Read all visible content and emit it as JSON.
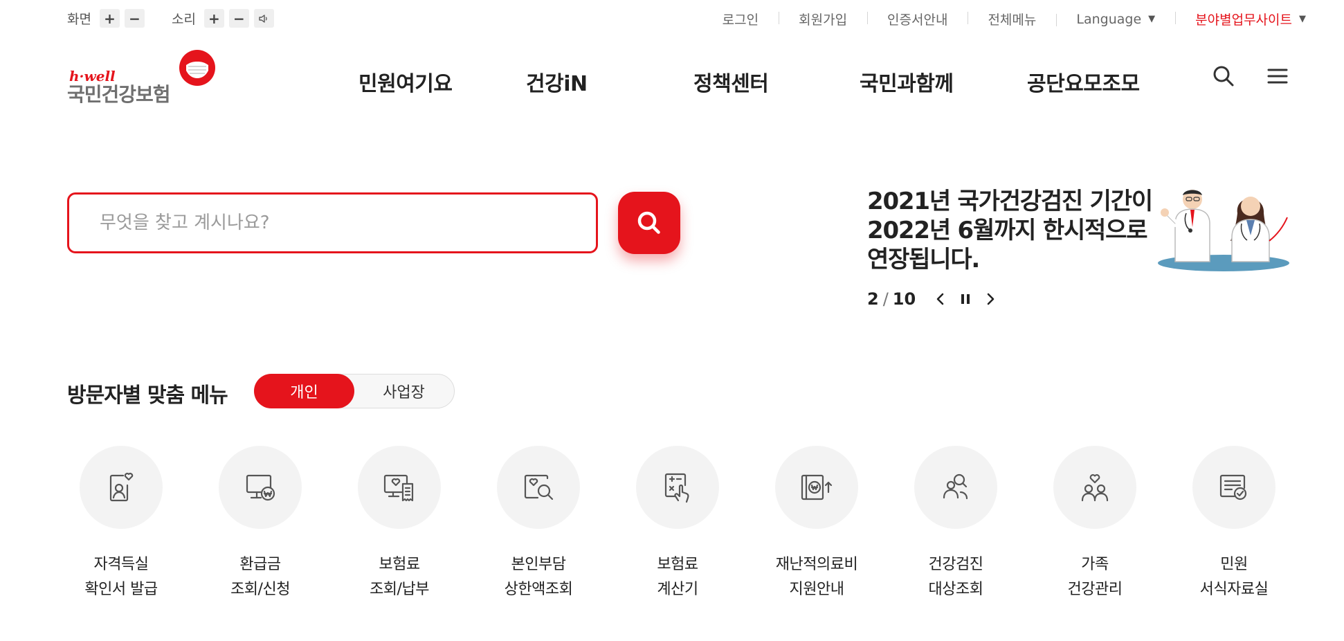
{
  "utility": {
    "screen_label": "화면",
    "sound_label": "소리",
    "plus": "+",
    "minus": "−",
    "links": {
      "login": "로그인",
      "signup": "회원가입",
      "cert": "인증서안내",
      "allmenu": "전체메뉴",
      "language": "Language",
      "business": "분야별업무사이트"
    }
  },
  "logo": {
    "small": "h·well",
    "main": "국민건강보험"
  },
  "gnb": [
    "민원여기요",
    "건강iN",
    "정책센터",
    "국민과함께",
    "공단요모조모"
  ],
  "search": {
    "placeholder": "무엇을 찾고 계시나요?"
  },
  "notice": {
    "title": "2021년 국가건강검진 기간이\n2022년 6월까지 한시적으로\n연장됩니다.",
    "current": "2",
    "total": "10"
  },
  "visitor_menu": {
    "title": "방문자별 맞춤 메뉴",
    "tab_personal": "개인",
    "tab_business": "사업장",
    "items": [
      {
        "label": "자격득실\n확인서 발급",
        "icon": "id-card-heart-icon"
      },
      {
        "label": "환급금\n조회/신청",
        "icon": "monitor-won-icon"
      },
      {
        "label": "보험료\n조회/납부",
        "icon": "monitor-receipt-icon"
      },
      {
        "label": "본인부담\n상한액조회",
        "icon": "search-heart-icon"
      },
      {
        "label": "보험료\n계산기",
        "icon": "calculator-hand-icon"
      },
      {
        "label": "재난적의료비\n지원안내",
        "icon": "wallet-won-icon"
      },
      {
        "label": "건강검진\n대상조회",
        "icon": "people-search-icon"
      },
      {
        "label": "가족\n건강관리",
        "icon": "family-heart-icon"
      },
      {
        "label": "민원\n서식자료실",
        "icon": "document-check-icon"
      }
    ]
  },
  "colors": {
    "accent": "#e5141c",
    "text": "#222222",
    "muted": "#666666"
  }
}
